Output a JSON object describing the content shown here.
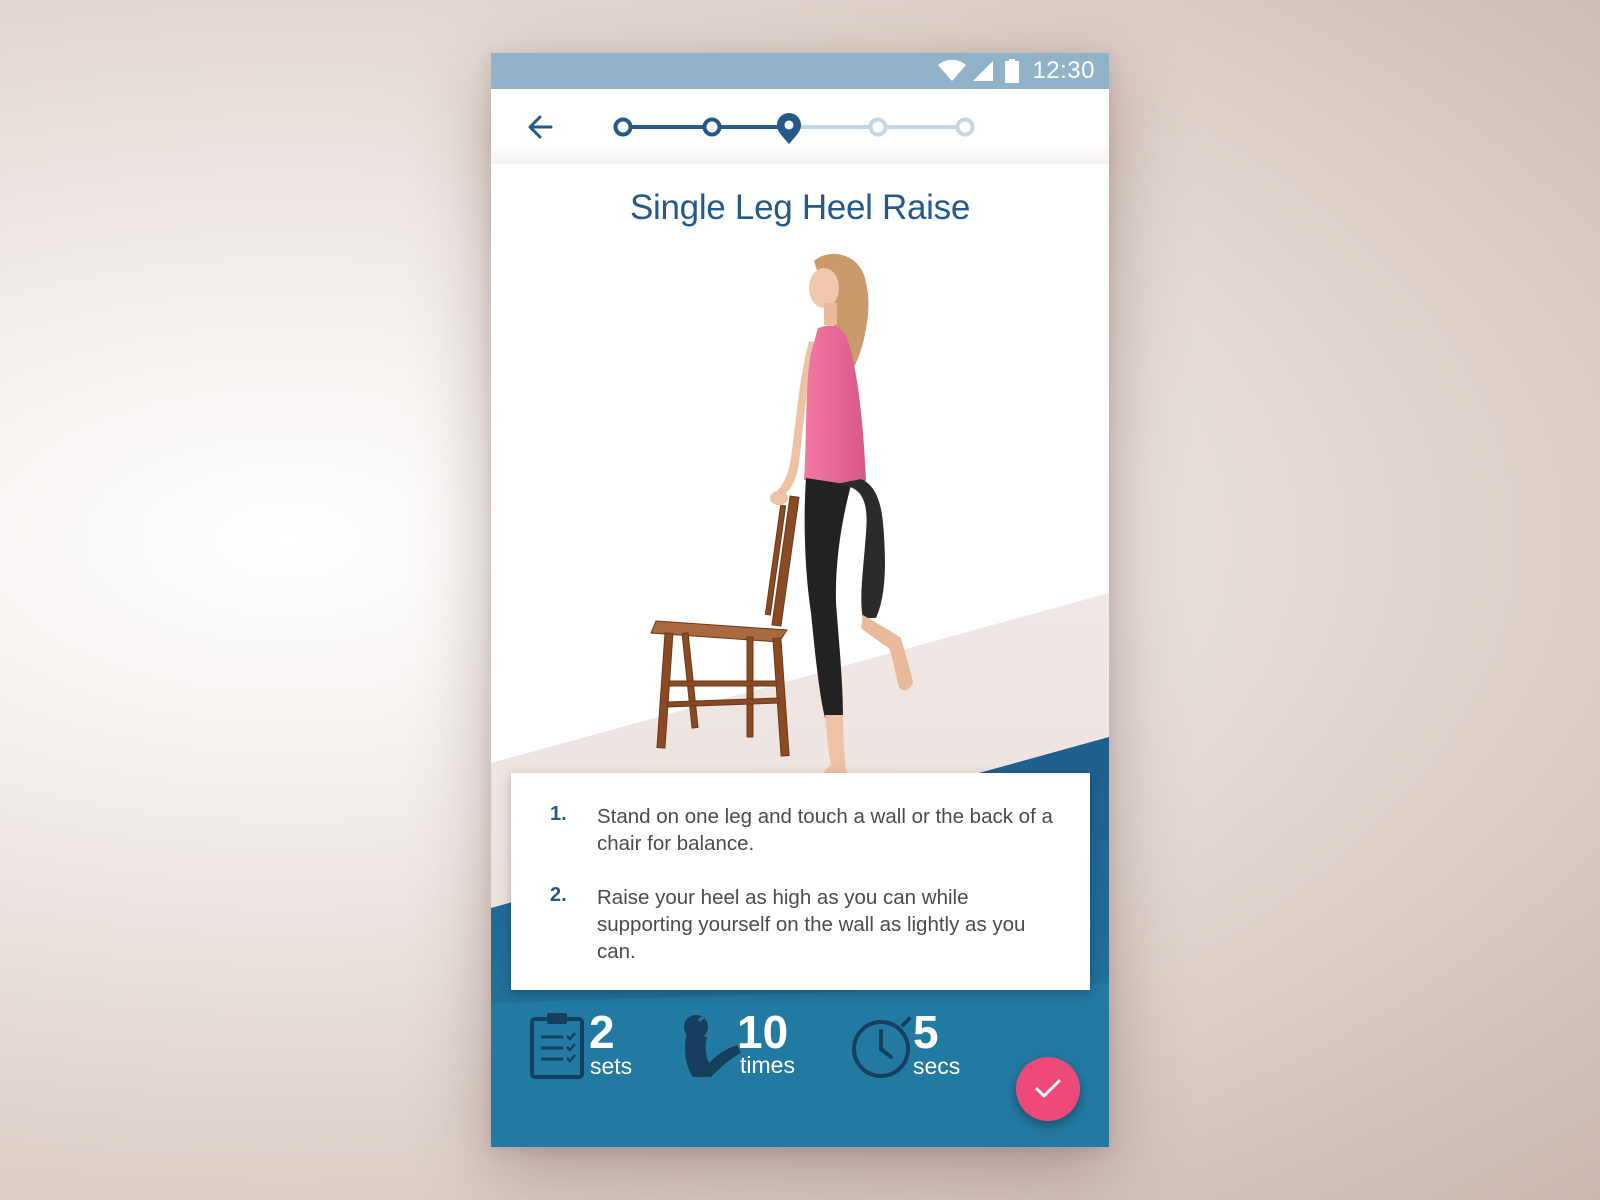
{
  "status_bar": {
    "time": "12:30",
    "icons": [
      "wifi-icon",
      "signal-icon",
      "battery-icon"
    ],
    "color": "#90b3c9"
  },
  "app_bar": {
    "back_icon": "arrow-left-icon",
    "progress": {
      "total_steps": 5,
      "current_step": 3
    }
  },
  "exercise": {
    "title": "Single Leg Heel Raise",
    "image": "woman-standing-at-chair-heel-raise",
    "steps": [
      {
        "number": "1.",
        "text": "Stand on one leg and touch a wall or the back of a chair for balance."
      },
      {
        "number": "2.",
        "text": "Raise your heel as high as you can while supporting yourself on the wall as lightly as you can."
      }
    ]
  },
  "stats": [
    {
      "icon": "clipboard-checklist-icon",
      "value": "2",
      "unit": "sets"
    },
    {
      "icon": "sit-up-icon",
      "value": "10",
      "unit": "times"
    },
    {
      "icon": "stopwatch-icon",
      "value": "5",
      "unit": "secs"
    }
  ],
  "fab": {
    "icon": "check-icon"
  },
  "colors": {
    "primary": "#24598a",
    "accent_blue": "#2a7aa3",
    "fab": "#ed4a79",
    "progress_inactive": "#c4d6e3"
  }
}
